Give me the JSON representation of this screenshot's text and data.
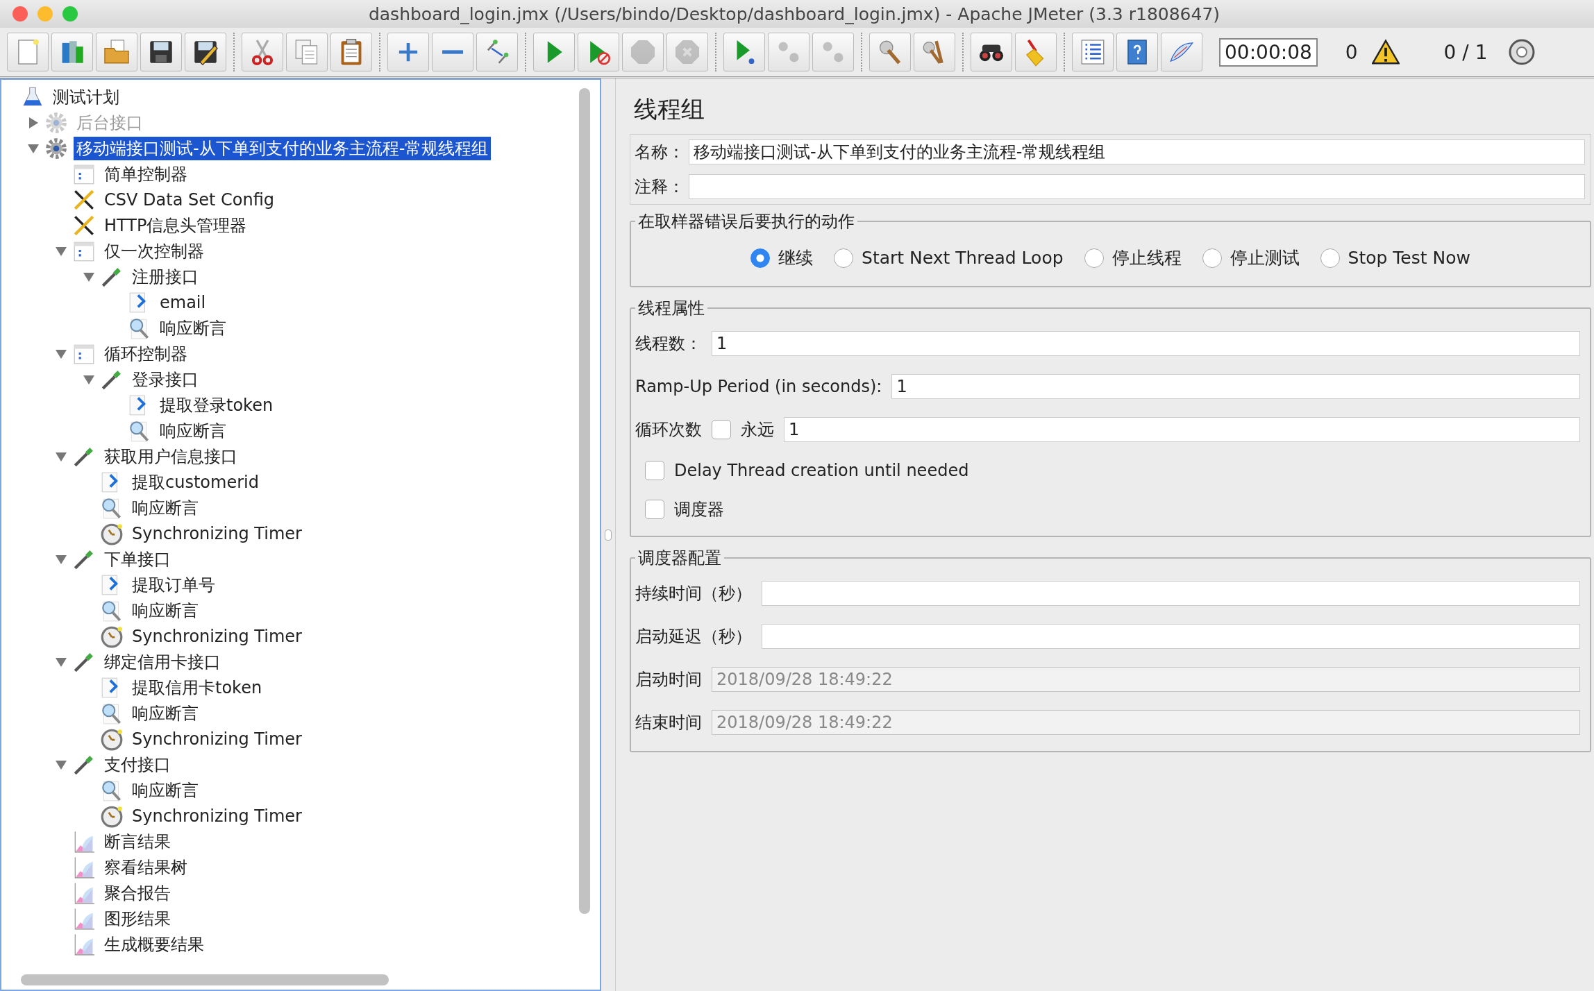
{
  "window": {
    "title": "dashboard_login.jmx (/Users/bindo/Desktop/dashboard_login.jmx) - Apache JMeter (3.3 r1808647)"
  },
  "toolbar": {
    "groups": [
      {
        "buttons": [
          {
            "kind": "new",
            "disabled": false
          },
          {
            "kind": "templates",
            "disabled": false
          },
          {
            "kind": "open",
            "disabled": false
          },
          {
            "kind": "save",
            "disabled": false
          },
          {
            "kind": "save-as",
            "disabled": false
          }
        ]
      },
      {
        "buttons": [
          {
            "kind": "cut",
            "disabled": false
          },
          {
            "kind": "copy",
            "disabled": false
          },
          {
            "kind": "paste",
            "disabled": false
          }
        ]
      },
      {
        "buttons": [
          {
            "kind": "expand",
            "disabled": false
          },
          {
            "kind": "collapse",
            "disabled": false
          },
          {
            "kind": "toggle",
            "disabled": false
          }
        ]
      },
      {
        "buttons": [
          {
            "kind": "start",
            "disabled": false
          },
          {
            "kind": "start-no-pause",
            "disabled": false
          },
          {
            "kind": "stop",
            "disabled": true
          },
          {
            "kind": "shutdown",
            "disabled": true
          }
        ]
      },
      {
        "buttons": [
          {
            "kind": "remote-start",
            "disabled": false
          },
          {
            "kind": "remote-stop",
            "disabled": true
          },
          {
            "kind": "remote-shutdown",
            "disabled": true
          }
        ]
      },
      {
        "buttons": [
          {
            "kind": "clear",
            "disabled": false
          },
          {
            "kind": "clear-all",
            "disabled": false
          }
        ]
      },
      {
        "buttons": [
          {
            "kind": "search",
            "disabled": false
          },
          {
            "kind": "reset-search",
            "disabled": false
          }
        ]
      },
      {
        "buttons": [
          {
            "kind": "function-helper",
            "disabled": false
          },
          {
            "kind": "help",
            "disabled": false
          },
          {
            "kind": "log",
            "disabled": false
          }
        ]
      }
    ],
    "timer": "00:00:08",
    "error_count": "0",
    "threads": "0 / 1"
  },
  "tree": {
    "label": "测试计划",
    "kind": "test-plan",
    "selected": false,
    "disabled": false,
    "children": [
      {
        "label": "后台接口",
        "kind": "thread-group",
        "selected": false,
        "disabled": true,
        "expanded": false
      },
      {
        "label": "移动端接口测试-从下单到支付的业务主流程-常规线程组",
        "kind": "thread-group",
        "selected": true,
        "disabled": false,
        "expanded": true,
        "children": [
          {
            "label": "简单控制器",
            "kind": "controller",
            "selected": false,
            "disabled": false
          },
          {
            "label": "CSV Data Set Config",
            "kind": "config",
            "selected": false,
            "disabled": false
          },
          {
            "label": "HTTP信息头管理器",
            "kind": "config",
            "selected": false,
            "disabled": false
          },
          {
            "label": "仅一次控制器",
            "kind": "controller",
            "selected": false,
            "disabled": false,
            "expanded": true,
            "children": [
              {
                "label": "注册接口",
                "kind": "sampler",
                "selected": false,
                "disabled": false,
                "expanded": true,
                "children": [
                  {
                    "label": "email",
                    "kind": "extractor",
                    "selected": false,
                    "disabled": false
                  },
                  {
                    "label": "响应断言",
                    "kind": "assertion",
                    "selected": false,
                    "disabled": false
                  }
                ]
              }
            ]
          },
          {
            "label": "循环控制器",
            "kind": "controller",
            "selected": false,
            "disabled": false,
            "expanded": true,
            "children": [
              {
                "label": "登录接口",
                "kind": "sampler",
                "selected": false,
                "disabled": false,
                "expanded": true,
                "children": [
                  {
                    "label": "提取登录token",
                    "kind": "extractor",
                    "selected": false,
                    "disabled": false
                  },
                  {
                    "label": "响应断言",
                    "kind": "assertion",
                    "selected": false,
                    "disabled": false
                  }
                ]
              }
            ]
          },
          {
            "label": "获取用户信息接口",
            "kind": "sampler",
            "selected": false,
            "disabled": false,
            "expanded": true,
            "children": [
              {
                "label": "提取customerid",
                "kind": "extractor",
                "selected": false,
                "disabled": false
              },
              {
                "label": "响应断言",
                "kind": "assertion",
                "selected": false,
                "disabled": false
              },
              {
                "label": "Synchronizing Timer",
                "kind": "timer",
                "selected": false,
                "disabled": false
              }
            ]
          },
          {
            "label": "下单接口",
            "kind": "sampler",
            "selected": false,
            "disabled": false,
            "expanded": true,
            "children": [
              {
                "label": "提取订单号",
                "kind": "extractor",
                "selected": false,
                "disabled": false
              },
              {
                "label": "响应断言",
                "kind": "assertion",
                "selected": false,
                "disabled": false
              },
              {
                "label": "Synchronizing Timer",
                "kind": "timer",
                "selected": false,
                "disabled": false
              }
            ]
          },
          {
            "label": "绑定信用卡接口",
            "kind": "sampler",
            "selected": false,
            "disabled": false,
            "expanded": true,
            "children": [
              {
                "label": "提取信用卡token",
                "kind": "extractor",
                "selected": false,
                "disabled": false
              },
              {
                "label": "响应断言",
                "kind": "assertion",
                "selected": false,
                "disabled": false
              },
              {
                "label": "Synchronizing Timer",
                "kind": "timer",
                "selected": false,
                "disabled": false
              }
            ]
          },
          {
            "label": "支付接口",
            "kind": "sampler",
            "selected": false,
            "disabled": false,
            "expanded": true,
            "children": [
              {
                "label": "响应断言",
                "kind": "assertion",
                "selected": false,
                "disabled": false
              },
              {
                "label": "Synchronizing Timer",
                "kind": "timer",
                "selected": false,
                "disabled": false
              }
            ]
          },
          {
            "label": "断言结果",
            "kind": "listener",
            "selected": false,
            "disabled": false
          },
          {
            "label": "察看结果树",
            "kind": "listener",
            "selected": false,
            "disabled": false
          },
          {
            "label": "聚合报告",
            "kind": "listener",
            "selected": false,
            "disabled": false
          },
          {
            "label": "图形结果",
            "kind": "listener",
            "selected": false,
            "disabled": false
          },
          {
            "label": "生成概要结果",
            "kind": "listener",
            "selected": false,
            "disabled": false
          }
        ]
      }
    ]
  },
  "panel": {
    "title": "线程组",
    "name": {
      "label": "名称：",
      "value": "移动端接口测试-从下单到支付的业务主流程-常规线程组"
    },
    "comments": {
      "label": "注释："
    },
    "error_action": {
      "legend": "在取样器错误后要执行的动作",
      "options": [
        {
          "label": "继续",
          "selected": true
        },
        {
          "label": "Start Next Thread Loop",
          "selected": false
        },
        {
          "label": "停止线程",
          "selected": false
        },
        {
          "label": "停止测试",
          "selected": false
        },
        {
          "label": "Stop Test Now",
          "selected": false
        }
      ]
    },
    "thread_properties": {
      "legend": "线程属性",
      "threads": {
        "label": "线程数：",
        "value": "1"
      },
      "ramp_up": {
        "label": "Ramp-Up Period (in seconds):",
        "value": "1"
      },
      "loop": {
        "label": "循环次数",
        "forever": {
          "label": "永远",
          "checked": false
        },
        "value": "1"
      },
      "delay": {
        "label": "Delay Thread creation until needed",
        "checked": false
      },
      "scheduler": {
        "label": "调度器",
        "checked": false
      }
    },
    "scheduler_config": {
      "legend": "调度器配置",
      "fields": [
        {
          "label": "持续时间（秒）",
          "disabled": false
        },
        {
          "label": "启动延迟（秒）",
          "disabled": false
        },
        {
          "label": "启动时间",
          "value": "2018/09/28 18:49:22",
          "disabled": true
        },
        {
          "label": "结束时间",
          "value": "2018/09/28 18:49:22",
          "disabled": true
        }
      ]
    }
  }
}
